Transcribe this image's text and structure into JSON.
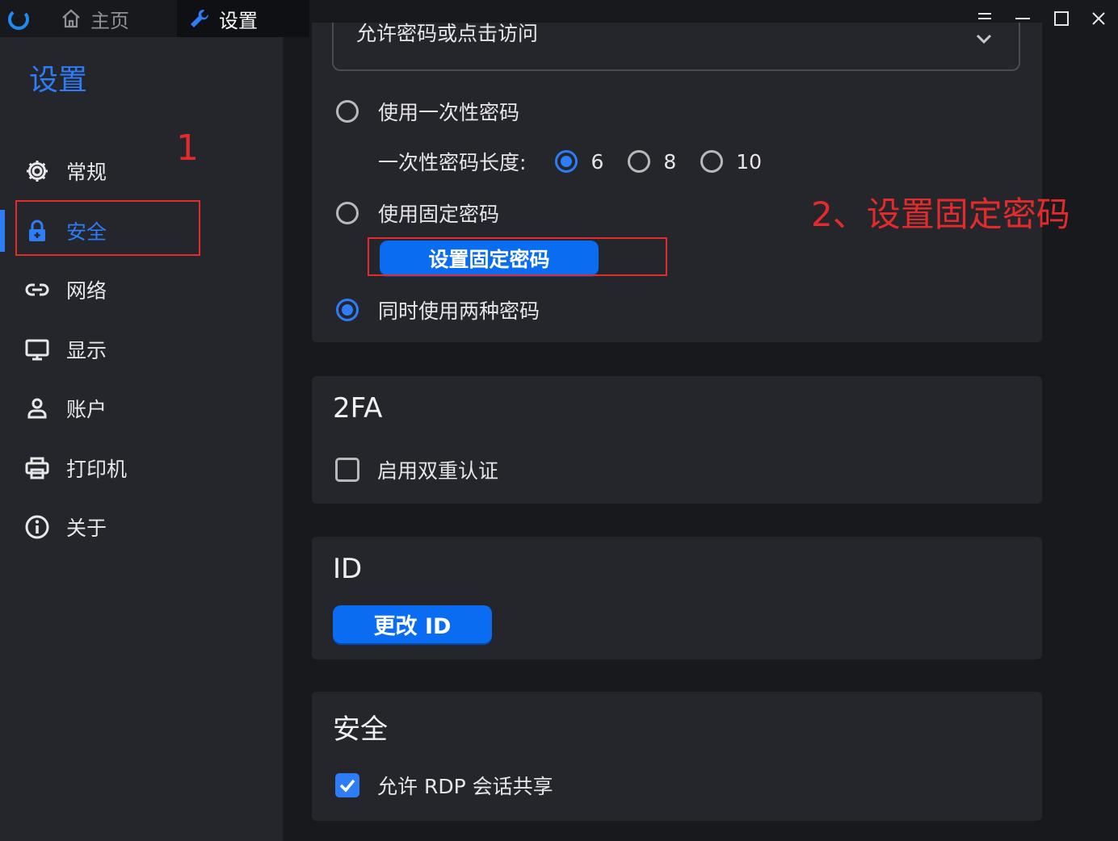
{
  "titlebar": {
    "tabs": [
      {
        "label": "主页",
        "icon": "home-icon"
      },
      {
        "label": "设置",
        "icon": "wrench-icon"
      }
    ],
    "window_controls": [
      "menu-icon",
      "minimize-icon",
      "maximize-icon",
      "close-icon"
    ]
  },
  "sidebar": {
    "title": "设置",
    "items": [
      {
        "label": "常规",
        "icon": "gear-icon"
      },
      {
        "label": "安全",
        "icon": "lock-icon",
        "active": true
      },
      {
        "label": "网络",
        "icon": "link-icon"
      },
      {
        "label": "显示",
        "icon": "monitor-icon"
      },
      {
        "label": "账户",
        "icon": "person-icon"
      },
      {
        "label": "打印机",
        "icon": "printer-icon"
      },
      {
        "label": "关于",
        "icon": "info-icon"
      }
    ]
  },
  "annotations": {
    "step1": "1",
    "step2": "2、设置固定密码"
  },
  "password": {
    "select_value": "允许密码或点击访问",
    "options": {
      "one_time": "使用一次性密码",
      "length_label": "一次性密码长度:",
      "lengths": [
        "6",
        "8",
        "10"
      ],
      "selected_length": "6",
      "fixed": "使用固定密码",
      "set_fixed_button": "设置固定密码",
      "both": "同时使用两种密码",
      "selected_option": "both"
    }
  },
  "twofa": {
    "title": "2FA",
    "enable_label": "启用双重认证",
    "enabled": false
  },
  "id": {
    "title": "ID",
    "change_button": "更改 ID"
  },
  "security": {
    "title": "安全",
    "rdp_label": "允许 RDP 会话共享",
    "rdp_enabled": true
  },
  "colors": {
    "accent": "#2e7cf6",
    "button": "#0a6cf0",
    "annotation": "#e32b2b",
    "sidebar_bg": "#25262b",
    "page_bg": "#18191d"
  }
}
